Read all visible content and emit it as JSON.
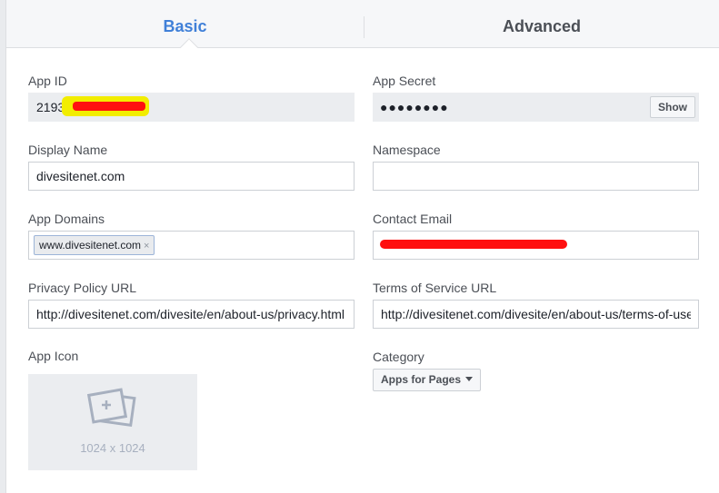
{
  "tabs": {
    "basic": "Basic",
    "advanced": "Advanced"
  },
  "fields": {
    "app_id": {
      "label": "App ID",
      "value": "2193"
    },
    "app_secret": {
      "label": "App Secret",
      "value": "●●●●●●●●",
      "show_label": "Show"
    },
    "display_name": {
      "label": "Display Name",
      "value": "divesitenet.com"
    },
    "namespace": {
      "label": "Namespace",
      "value": ""
    },
    "app_domains": {
      "label": "App Domains",
      "token": "www.divesitenet.com",
      "token_remove": "×"
    },
    "contact_email": {
      "label": "Contact Email",
      "value": ""
    },
    "privacy_policy_url": {
      "label": "Privacy Policy URL",
      "value": "http://divesitenet.com/divesite/en/about-us/privacy.html"
    },
    "terms_of_service_url": {
      "label": "Terms of Service URL",
      "value": "http://divesitenet.com/divesite/en/about-us/terms-of-use"
    },
    "app_icon": {
      "label": "App Icon",
      "size_text": "1024 x 1024",
      "icon": "image-placeholder-icon"
    },
    "category": {
      "label": "Category",
      "value": "Apps for Pages",
      "icon": "caret-down-icon"
    }
  },
  "colors": {
    "accent": "#4080d8",
    "redaction_yellow": "#f2ed00",
    "redaction_red": "#ff1010"
  }
}
